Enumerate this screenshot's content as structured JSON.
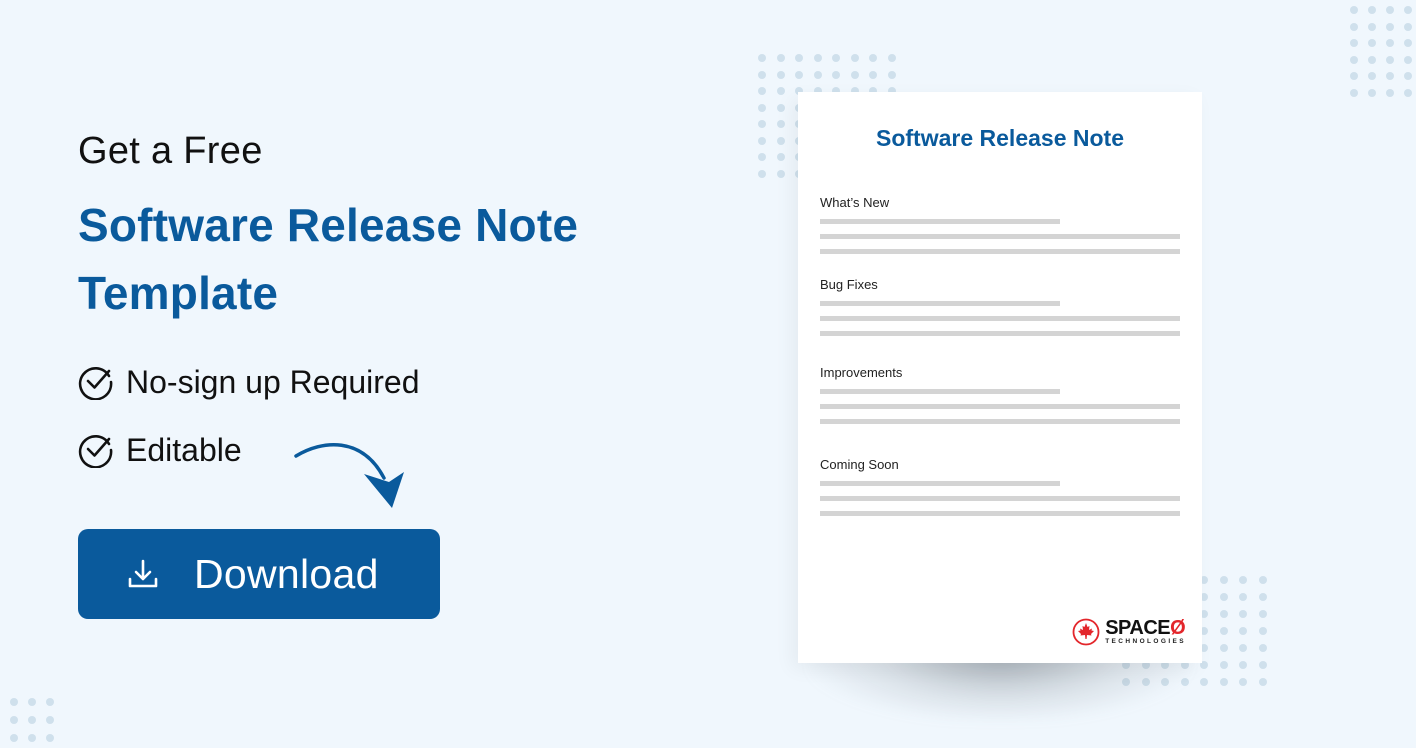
{
  "hero": {
    "eyebrow": "Get a Free",
    "title_line1": "Software Release Note",
    "title_line2": "Template"
  },
  "features": [
    {
      "icon": "check-circle-icon",
      "label": "No-sign up Required"
    },
    {
      "icon": "check-circle-icon",
      "label": "Editable"
    }
  ],
  "cta": {
    "icon": "download-icon",
    "label": "Download"
  },
  "document": {
    "title": "Software Release Note",
    "sections": [
      {
        "label": "What’s New"
      },
      {
        "label": "Bug Fixes"
      },
      {
        "label": "Improvements"
      },
      {
        "label": "Coming Soon"
      }
    ],
    "brand": {
      "name": "SPACE",
      "name_suffix": "Ø",
      "tagline": "TECHNOLOGIES"
    }
  },
  "colors": {
    "brand_blue": "#0a5a9c",
    "background": "#f0f7fd",
    "brand_red": "#e3262b"
  }
}
